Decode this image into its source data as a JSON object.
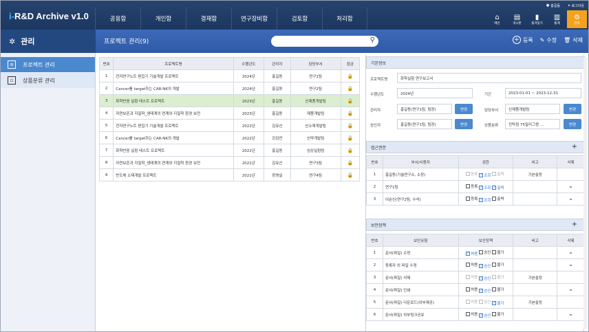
{
  "app": {
    "title": "R&D Archive v1.0",
    "logo_prefix": "i-"
  },
  "userbar": {
    "user": "홍길동",
    "logout": "로그아웃"
  },
  "nav": [
    "공용함",
    "개인함",
    "결재함",
    "연구장비함",
    "검토함",
    "처리함"
  ],
  "top_icons": [
    {
      "label": "메인",
      "icon": "home-icon"
    },
    {
      "label": "게시판",
      "icon": "board-icon"
    },
    {
      "label": "즐겨찾기",
      "icon": "bookmark-icon"
    },
    {
      "label": "통계",
      "icon": "stats-icon"
    },
    {
      "label": "관리",
      "icon": "gear-icon"
    }
  ],
  "section": {
    "title": "관리",
    "page_title": "프로젝트 관리(9)",
    "search_placeholder": ""
  },
  "actions": {
    "register": "등록",
    "edit": "수정",
    "delete": "삭제"
  },
  "sidebar": [
    {
      "label": "프로젝트 관리",
      "active": true
    },
    {
      "label": "상품분류 관리",
      "active": false
    }
  ],
  "project_table": {
    "headers": [
      "번호",
      "프로젝트명",
      "수행년도",
      "관리자",
      "담당부서",
      "잠금"
    ],
    "rows": [
      {
        "no": "1",
        "name": "전자연구노트 편집기 기술개발 프로젝트",
        "year": "2024년",
        "mgr": "홍길동",
        "dept": "연구1팀",
        "lock": false
      },
      {
        "no": "2",
        "name": "Cancer를 target하는 CAR-NK의 개발",
        "year": "2024년",
        "mgr": "홍길동",
        "dept": "연구2팀",
        "lock": false
      },
      {
        "no": "3",
        "name": "화학반응 실험 테스트 프로젝트",
        "year": "2023년",
        "mgr": "홍길동",
        "dept": "신제품개발팀",
        "lock": false,
        "selected": true
      },
      {
        "no": "4",
        "name": "자연보존과 지질학_생태계의 연계와 지질학 환경 보전",
        "year": "2023년",
        "mgr": "홍길동",
        "dept": "제품개발팀",
        "lock": true
      },
      {
        "no": "5",
        "name": "전자연구노트 편집기 기술개발 프로젝트",
        "year": "2022년",
        "mgr": "김유신",
        "dept": "신소재개발팀",
        "lock": false
      },
      {
        "no": "6",
        "name": "Cancer를 target하는 CAR-NK의 개발",
        "year": "2022년",
        "mgr": "강감찬",
        "dept": "신약개발팀",
        "lock": true
      },
      {
        "no": "7",
        "name": "화학반응 실험 테스트 프로젝트",
        "year": "2022년",
        "mgr": "홍길동",
        "dept": "임상실험팀",
        "lock": false
      },
      {
        "no": "8",
        "name": "자연보존과 지질학_생태계의 연계와 지질학 환경 보전",
        "year": "2021년",
        "mgr": "김유신",
        "dept": "연구3팀",
        "lock": true
      },
      {
        "no": "9",
        "name": "반도체 소재개발 프로젝트",
        "year": "2021년",
        "mgr": "장영실",
        "dept": "연구4팀",
        "lock": false
      }
    ]
  },
  "basic": {
    "title": "기본정보",
    "project_label": "프로젝트명",
    "project_value": "화학실험 연구보고서",
    "year_label": "수행년도",
    "year_value": "2024년",
    "period_label": "기간",
    "period_value": "2023-01-01 ~ 2023-12-31",
    "mgr_label": "관리자",
    "mgr_value": "홍길동(연구1팀, 팀장)",
    "dept_label": "담당부서",
    "dept_value": "신제품개발팀",
    "approver_label": "승인자",
    "approver_value": "홍길동(연구1팀, 팀장)",
    "product_label": "상품분류",
    "product_value": "진탁점 75밀리그람 ...",
    "change": "변경"
  },
  "access": {
    "title": "접근권한",
    "headers": [
      "번호",
      "부서/사용자",
      "권한",
      "비고",
      "삭제"
    ],
    "perm_labels": [
      "등록",
      "조회",
      "출력"
    ],
    "rows": [
      {
        "no": "1",
        "name": "홍길동(기술연구소, 소장)",
        "perms": [
          "dis",
          "on",
          "dis"
        ],
        "note": "기본설정",
        "del": ""
      },
      {
        "no": "2",
        "name": "연구1팀",
        "perms": [
          "off",
          "on",
          "on"
        ],
        "note": "",
        "del": "–"
      },
      {
        "no": "3",
        "name": "이순신(연구2팀, 수석)",
        "perms": [
          "off",
          "on",
          "off"
        ],
        "note": "",
        "del": "–"
      }
    ]
  },
  "security": {
    "title": "보안정책",
    "headers": [
      "번호",
      "보안유형",
      "보안정책",
      "비고",
      "삭제"
    ],
    "perm_labels": [
      "허용",
      "승인",
      "불가"
    ],
    "rows": [
      {
        "no": "1",
        "name": "문서(파일) 수정",
        "perms": [
          "on",
          "off",
          "off"
        ],
        "note": "",
        "del": "–"
      },
      {
        "no": "2",
        "name": "등록자 외 파일 수정",
        "perms": [
          "off",
          "on",
          "off"
        ],
        "note": "",
        "del": "–"
      },
      {
        "no": "3",
        "name": "문서(파일) 삭제",
        "perms": [
          "dis",
          "on",
          "dis"
        ],
        "note": "기본설정",
        "del": ""
      },
      {
        "no": "4",
        "name": "문서(파일) 인쇄",
        "perms": [
          "off",
          "on",
          "off"
        ],
        "note": "",
        "del": "–"
      },
      {
        "no": "5",
        "name": "문서(파일) 다운로드(외부제공)",
        "perms": [
          "dis",
          "dis",
          "on"
        ],
        "note": "기본설정",
        "del": ""
      },
      {
        "no": "6",
        "name": "문서(파일) 외부링크공유",
        "perms": [
          "off",
          "on",
          "off"
        ],
        "note": "",
        "del": "–"
      }
    ]
  }
}
